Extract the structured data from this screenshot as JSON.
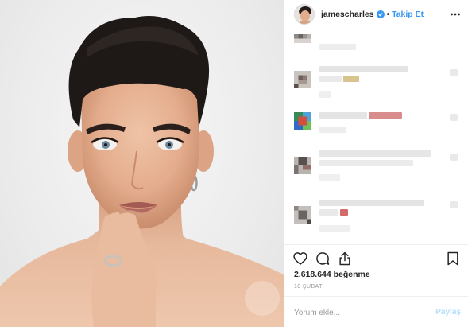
{
  "header": {
    "username": "jamescharles",
    "separator": "•",
    "follow_label": "Takip Et"
  },
  "icons": {
    "verified": "verified-badge-icon",
    "more": "more-options-icon",
    "like": "heart-icon",
    "comment": "comment-icon",
    "share": "share-icon",
    "save": "bookmark-icon"
  },
  "post": {
    "likes": "2.618.644 beğenme",
    "date": "10 ŞUBAT"
  },
  "add_comment": {
    "placeholder": "Yorum ekle...",
    "post_label": "Paylaş"
  },
  "colors": {
    "accent": "#3897f0",
    "accent_disabled": "#b2dffc",
    "border": "#efefef",
    "muted": "#999999"
  }
}
